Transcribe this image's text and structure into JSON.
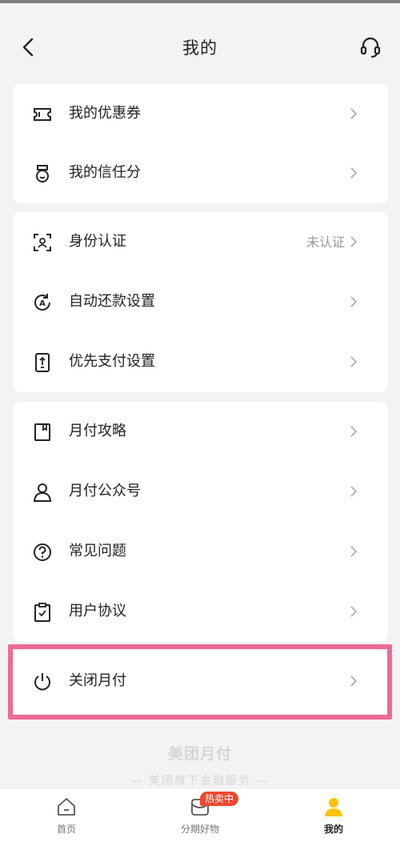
{
  "nav": {
    "title": "我的",
    "back_icon": "chevron-left-icon",
    "support_icon": "headset-icon"
  },
  "group1": [
    {
      "label": "我的优惠券",
      "icon": "coupon-icon"
    },
    {
      "label": "我的信任分",
      "icon": "medal-icon"
    }
  ],
  "group2": [
    {
      "label": "身份认证",
      "icon": "id-scan-icon",
      "value": "未认证"
    },
    {
      "label": "自动还款设置",
      "icon": "auto-repay-icon"
    },
    {
      "label": "优先支付设置",
      "icon": "priority-pay-icon"
    }
  ],
  "group3": [
    {
      "label": "月付攻略",
      "icon": "guide-icon"
    },
    {
      "label": "月付公众号",
      "icon": "person-icon"
    },
    {
      "label": "常见问题",
      "icon": "question-icon"
    },
    {
      "label": "用户协议",
      "icon": "agreement-icon"
    }
  ],
  "group4": [
    {
      "label": "关闭月付",
      "icon": "power-icon"
    }
  ],
  "footer": {
    "brand": "美团月付",
    "sub": "— 美团旗下金融服务 —"
  },
  "tabs": [
    {
      "label": "首页",
      "icon": "home-icon"
    },
    {
      "label": "分期好物",
      "icon": "bag-icon",
      "badge": "热卖中"
    },
    {
      "label": "我的",
      "icon": "user-icon",
      "active": true
    }
  ],
  "colors": {
    "highlight": "#ec6b93",
    "accent": "#ffc300",
    "badge": "#f0472f"
  }
}
